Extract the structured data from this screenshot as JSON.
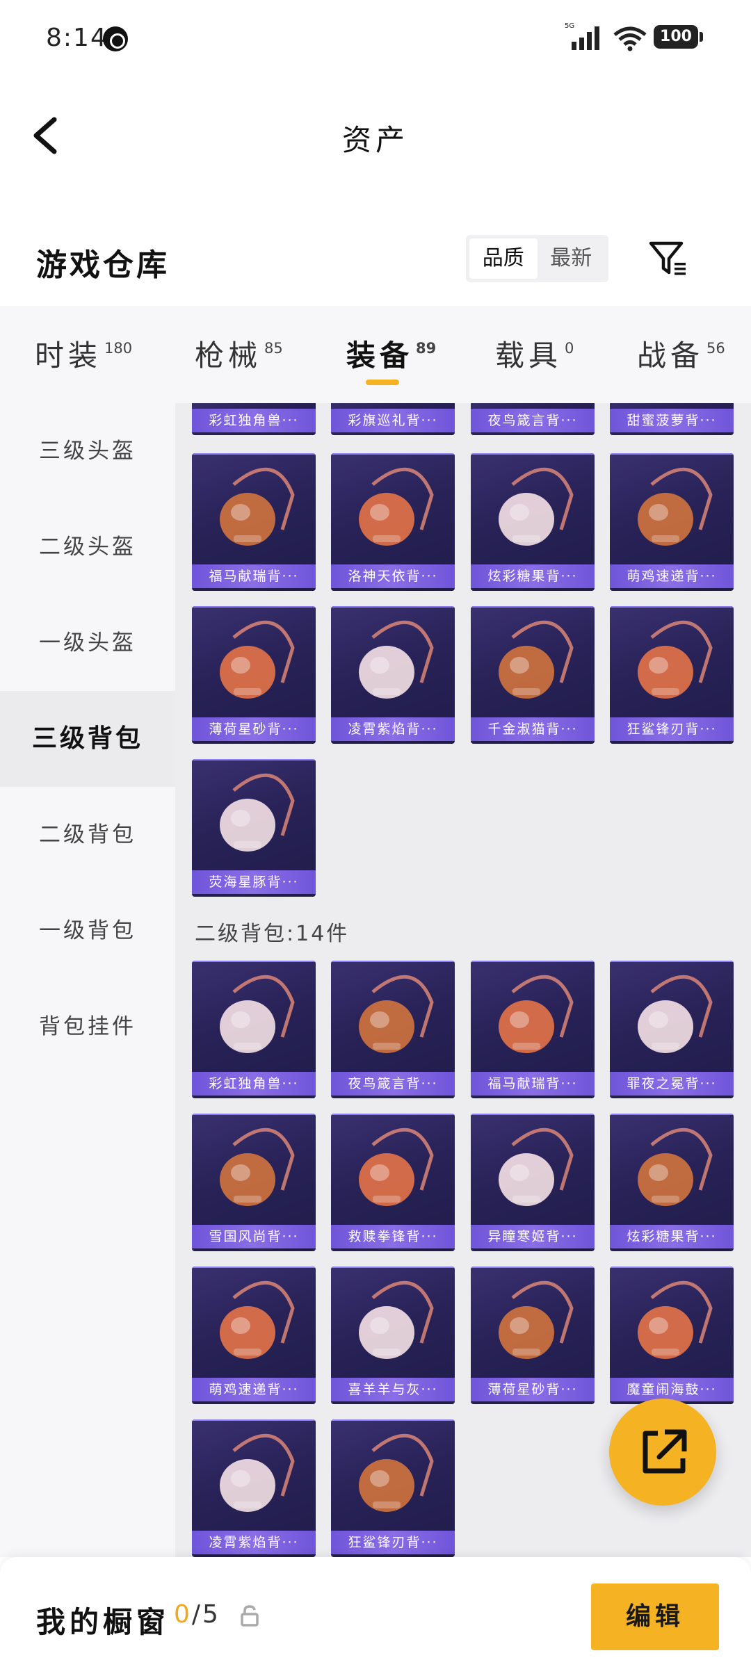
{
  "status_bar": {
    "time": "8:14",
    "battery": "100",
    "network": "5G"
  },
  "header": {
    "title": "资产"
  },
  "section": {
    "title": "游戏仓库",
    "sort_quality": "品质",
    "sort_latest": "最新"
  },
  "tabs": [
    {
      "label": "时装",
      "count": "180"
    },
    {
      "label": "枪械",
      "count": "85"
    },
    {
      "label": "装备",
      "count": "89"
    },
    {
      "label": "载具",
      "count": "0"
    },
    {
      "label": "战备",
      "count": "56"
    }
  ],
  "active_tab": "装备",
  "sidebar": [
    {
      "label": "三级头盔"
    },
    {
      "label": "二级头盔"
    },
    {
      "label": "一级头盔"
    },
    {
      "label": "三级背包"
    },
    {
      "label": "二级背包"
    },
    {
      "label": "一级背包"
    },
    {
      "label": "背包挂件"
    }
  ],
  "active_sidebar": "三级背包",
  "level3_items": [
    {
      "name": "彩虹独角兽···"
    },
    {
      "name": "彩旗巡礼背···"
    },
    {
      "name": "夜鸟箴言背···"
    },
    {
      "name": "甜蜜菠萝背···"
    },
    {
      "name": "福马献瑞背···"
    },
    {
      "name": "洛神天依背···"
    },
    {
      "name": "炫彩糖果背···"
    },
    {
      "name": "萌鸡速递背···"
    },
    {
      "name": "薄荷星砂背···"
    },
    {
      "name": "凌霄紫焰背···"
    },
    {
      "name": "千金淑猫背···"
    },
    {
      "name": "狂鲨锋刃背···"
    },
    {
      "name": "荧海星豚背···"
    }
  ],
  "level2_group": {
    "label": "二级背包:14件"
  },
  "level2_items": [
    {
      "name": "彩虹独角兽···"
    },
    {
      "name": "夜鸟箴言背···"
    },
    {
      "name": "福马献瑞背···"
    },
    {
      "name": "罪夜之冕背···"
    },
    {
      "name": "雪国风尚背···"
    },
    {
      "name": "救赎拳锋背···"
    },
    {
      "name": "异瞳寒姬背···"
    },
    {
      "name": "炫彩糖果背···"
    },
    {
      "name": "萌鸡速递背···"
    },
    {
      "name": "喜羊羊与灰···"
    },
    {
      "name": "薄荷星砂背···"
    },
    {
      "name": "魔童闹海鼓···"
    },
    {
      "name": "凌霄紫焰背···"
    },
    {
      "name": "狂鲨锋刃背···"
    }
  ],
  "bottom": {
    "label": "我的橱窗",
    "count_current": "0",
    "count_total": "/5",
    "edit": "编辑"
  },
  "colors": {
    "accent": "#f5b324",
    "card_bg": "#282257",
    "card_label": "#7a62e0"
  }
}
